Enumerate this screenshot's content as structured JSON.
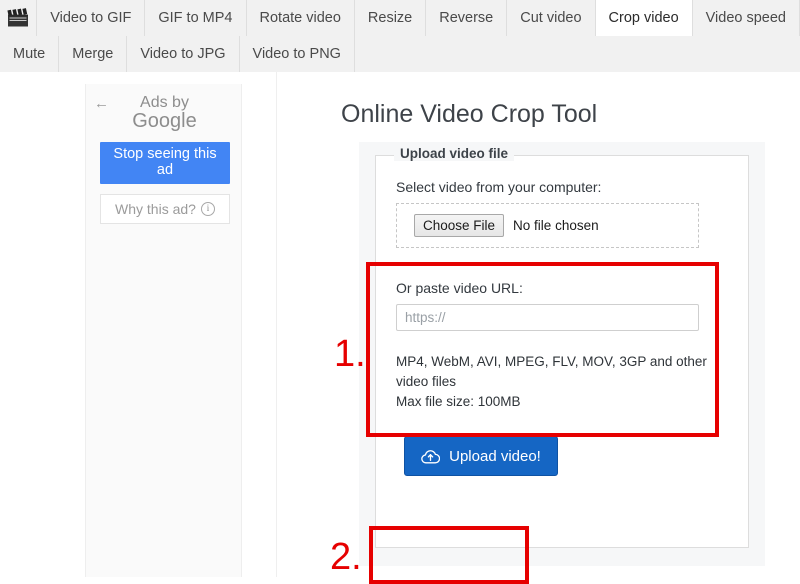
{
  "nav": {
    "logo_icon": "clapperboard-icon",
    "row1": [
      {
        "label": "Video to GIF",
        "active": false
      },
      {
        "label": "GIF to MP4",
        "active": false
      },
      {
        "label": "Rotate video",
        "active": false
      },
      {
        "label": "Resize",
        "active": false
      },
      {
        "label": "Reverse",
        "active": false
      },
      {
        "label": "Cut video",
        "active": false
      },
      {
        "label": "Crop video",
        "active": true
      },
      {
        "label": "Video speed",
        "active": false
      }
    ],
    "row2": [
      {
        "label": "Mute",
        "active": false
      },
      {
        "label": "Merge",
        "active": false
      },
      {
        "label": "Video to JPG",
        "active": false
      },
      {
        "label": "Video to PNG",
        "active": false
      }
    ]
  },
  "ad": {
    "back_arrow": "←",
    "ads_by_line1": "Ads by",
    "ads_by_line2": "Google",
    "stop_seeing_label": "Stop seeing this ad",
    "why_this_ad_label": "Why this ad?",
    "info_glyph": "i",
    "button_color": "#4285f4"
  },
  "main": {
    "title": "Online Video Crop Tool",
    "fieldset_legend": "Upload video file",
    "label_select_video": "Select video from your computer:",
    "choose_file_label": "Choose File",
    "no_file_chosen": "No file chosen",
    "label_paste_url": "Or paste video URL:",
    "url_value": "",
    "url_placeholder": "https://",
    "format_note": "MP4, WebM, AVI, MPEG, FLV, MOV, 3GP and other video files",
    "max_file_size": "Max file size: 100MB",
    "upload_button_label": "Upload video!",
    "upload_button_icon": "cloud-upload-icon",
    "upload_button_color": "#1566c4"
  },
  "annotations": {
    "step1_number": "1.",
    "step2_number": "2.",
    "highlight_color": "#e60000"
  }
}
